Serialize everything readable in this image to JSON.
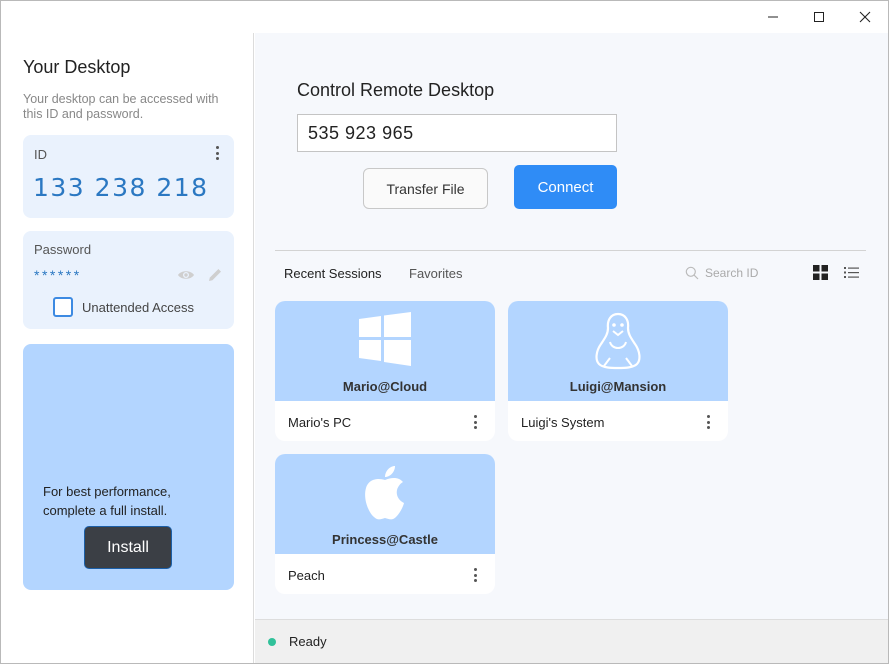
{
  "window": {
    "controls": [
      "minimize-icon",
      "maximize-icon",
      "close-icon"
    ]
  },
  "left_panel": {
    "title": "Your Desktop",
    "description": "Your desktop can be accessed with this ID and password.",
    "id_card": {
      "label": "ID",
      "value": "133 238 218"
    },
    "password_card": {
      "label": "Password",
      "value": "******",
      "unattended_label": "Unattended Access",
      "unattended_checked": false
    },
    "install_card": {
      "message": "For best performance, complete a full install.",
      "button_label": "Install"
    }
  },
  "control": {
    "title": "Control Remote Desktop",
    "remote_id_value": "535 923 965",
    "transfer_label": "Transfer File",
    "connect_label": "Connect"
  },
  "sessions_panel": {
    "tabs": [
      {
        "label": "Recent Sessions",
        "active": true
      },
      {
        "label": "Favorites",
        "active": false
      }
    ],
    "search_placeholder": "Search ID",
    "view_modes": [
      "grid-view-icon",
      "list-view-icon"
    ],
    "items": [
      {
        "host": "Mario@Cloud",
        "name": "Mario's PC",
        "os_icon": "windows-icon"
      },
      {
        "host": "Luigi@Mansion",
        "name": "Luigi's System",
        "os_icon": "linux-icon"
      },
      {
        "host": "Princess@Castle",
        "name": "Peach",
        "os_icon": "apple-icon"
      }
    ]
  },
  "status_bar": {
    "text": "Ready",
    "color": "#31c19a"
  },
  "colors": {
    "accent": "#2f8cf6",
    "card_blue": "#b3d5ff",
    "id_text": "#2b78c2"
  }
}
